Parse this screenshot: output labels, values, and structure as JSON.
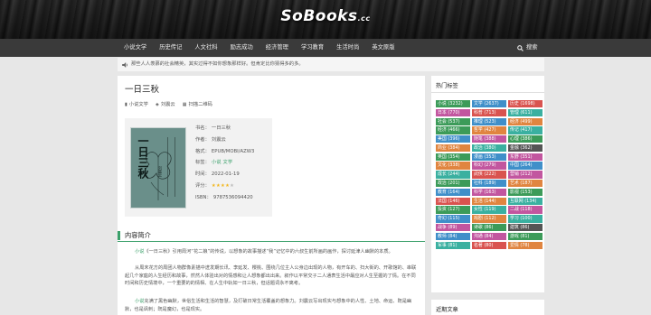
{
  "site": {
    "logo": "SoBooks",
    "logo_suffix": ".cc"
  },
  "nav": {
    "items": [
      "小说文学",
      "历史传记",
      "人文社科",
      "励志成功",
      "经济管理",
      "学习教育",
      "生活时尚",
      "英文原版"
    ],
    "search_label": "搜索"
  },
  "notice": {
    "text": "那些人人羡慕的社会精英，其实过得不如你想象那样好。但肯定比你猜得多的多。"
  },
  "book": {
    "title": "一日三秋",
    "category": "小说文学",
    "author_tag": "刘震云",
    "qr_label": "扫描二维码",
    "cover_title": "一日三秋",
    "cover_author": "刘震云",
    "info": {
      "title_label": "书名：",
      "title_value": "一日三秋",
      "author_label": "作者：",
      "author_value": "刘震云",
      "format_label": "格式：",
      "format_value": "EPUB/MOBI/AZW3",
      "tags_label": "标签：",
      "tags_value_1": "小说",
      "tags_value_2": "文学",
      "date_label": "时间：",
      "date_value": "2022-01-19",
      "rating_label": "评分：",
      "rating_value": 4,
      "isbn_label": "ISBN：",
      "isbn_value": "9787536094420"
    }
  },
  "section": {
    "title": "内容简介"
  },
  "content": {
    "p1_link": "小说",
    "p1": "《一日三秋》引用周河“花二娘”的传说，以想象的故事描述“我”记忆中的六叔生前所画的画作，探讨延津人幽默的本质。",
    "p2": "从周末花方的周团人物群像素描中迸发期长讯、李延发、樱桃、围绕几位主人公身边出现的人物，有开车的、扫大街的、开歌馆的、串联起几个家庭的人生经历和故事，然然人体验出对的情感和让人想象都出出来。叙作以平常交子二人通表生活中最应对人生至握的了情。在不同时间和历史情境中，一个重要的的情相、在人生中轨如一日三秋，但话题词永不离考。",
    "p3_link": "小说",
    "p3": "充满了黑色幽默，世俗生活和生活的智慧，及打破日常生活覆盖的想象力。刘震云写出现实与想象中的人性、土地、命运、既是幽默，也是讽刺；既是魔幻，也是现实。"
  },
  "sidebar": {
    "hot_tags_title": "热门标签",
    "recent_title": "近期文章",
    "tags": [
      {
        "label": "小说 (3232)",
        "color": "#3c9b59"
      },
      {
        "label": "文学 (2637)",
        "color": "#3f8fc9"
      },
      {
        "label": "历史 (1698)",
        "color": "#d9534f"
      },
      {
        "label": "日本 (770)",
        "color": "#c2569f"
      },
      {
        "label": "科普 (713)",
        "color": "#d9534f"
      },
      {
        "label": "管理 (611)",
        "color": "#3ab0a0"
      },
      {
        "label": "社会 (537)",
        "color": "#3c9b59"
      },
      {
        "label": "推理 (523)",
        "color": "#3f8fc9"
      },
      {
        "label": "经济 (499)",
        "color": "#e08540"
      },
      {
        "label": "经济 (466)",
        "color": "#3c9b59"
      },
      {
        "label": "哲学 (427)",
        "color": "#e08540"
      },
      {
        "label": "传记 (417)",
        "color": "#3ab0a0"
      },
      {
        "label": "美国 (396)",
        "color": "#3f8fc9"
      },
      {
        "label": "随笔 (388)",
        "color": "#c2569f"
      },
      {
        "label": "心理 (386)",
        "color": "#3c9b59"
      },
      {
        "label": "商业 (384)",
        "color": "#e08540"
      },
      {
        "label": "政治 (380)",
        "color": "#3ab0a0"
      },
      {
        "label": "金融 (362)",
        "color": "#555555"
      },
      {
        "label": "英国 (354)",
        "color": "#3c9b59"
      },
      {
        "label": "漫画 (353)",
        "color": "#3f8fc9"
      },
      {
        "label": "东野 (351)",
        "color": "#c2569f"
      },
      {
        "label": "文化 (338)",
        "color": "#e08540"
      },
      {
        "label": "科幻 (279)",
        "color": "#c2569f"
      },
      {
        "label": "中国 (264)",
        "color": "#3f8fc9"
      },
      {
        "label": "成长 (244)",
        "color": "#3ab0a0"
      },
      {
        "label": "武侠 (222)",
        "color": "#d9534f"
      },
      {
        "label": "营销 (212)",
        "color": "#c2569f"
      },
      {
        "label": "政治 (201)",
        "color": "#3c9b59"
      },
      {
        "label": "社科 (189)",
        "color": "#3f8fc9"
      },
      {
        "label": "艺术 (187)",
        "color": "#e08540"
      },
      {
        "label": "教育 (164)",
        "color": "#3f8fc9"
      },
      {
        "label": "科学 (163)",
        "color": "#c2569f"
      },
      {
        "label": "影视 (153)",
        "color": "#3c9b59"
      },
      {
        "label": "法国 (146)",
        "color": "#d9534f"
      },
      {
        "label": "生活 (144)",
        "color": "#e08540"
      },
      {
        "label": "互联网 (134)",
        "color": "#3ab0a0"
      },
      {
        "label": "投资 (127)",
        "color": "#3c9b59"
      },
      {
        "label": "女性 (119)",
        "color": "#3ab0a0"
      },
      {
        "label": "二战 (118)",
        "color": "#c2569f"
      },
      {
        "label": "奇幻 (115)",
        "color": "#3f8fc9"
      },
      {
        "label": "戏剧 (112)",
        "color": "#e08540"
      },
      {
        "label": "学习 (100)",
        "color": "#3ab0a0"
      },
      {
        "label": "战争 (89)",
        "color": "#c2569f"
      },
      {
        "label": "诗歌 (86)",
        "color": "#3c9b59"
      },
      {
        "label": "建筑 (86)",
        "color": "#555555"
      },
      {
        "label": "教师 (84)",
        "color": "#3f8fc9"
      },
      {
        "label": "沟通 (84)",
        "color": "#c2569f"
      },
      {
        "label": "游戏 (81)",
        "color": "#3c9b59"
      },
      {
        "label": "军事 (81)",
        "color": "#3ab0a0"
      },
      {
        "label": "名著 (80)",
        "color": "#d9534f"
      },
      {
        "label": "爱情 (78)",
        "color": "#e08540"
      }
    ]
  }
}
